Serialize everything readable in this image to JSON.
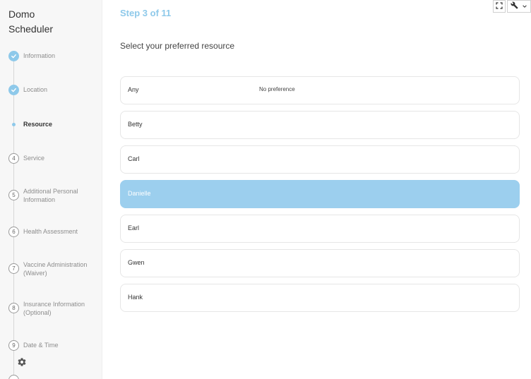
{
  "app": {
    "title_line1": "Domo",
    "title_line2": "Scheduler"
  },
  "steps": [
    {
      "label": "Information",
      "status": "done"
    },
    {
      "label": "Location",
      "status": "done"
    },
    {
      "label": "Resource",
      "status": "current"
    },
    {
      "label": "Service",
      "status": "todo",
      "number": "4"
    },
    {
      "label": "Additional Personal Information",
      "status": "todo",
      "number": "5"
    },
    {
      "label": "Health Assessment",
      "status": "todo",
      "number": "6"
    },
    {
      "label": "Vaccine Administration (Waiver)",
      "status": "todo",
      "number": "7"
    },
    {
      "label": "Insurance Information (Optional)",
      "status": "todo",
      "number": "8"
    },
    {
      "label": "Date & Time",
      "status": "todo",
      "number": "9"
    }
  ],
  "main": {
    "step_count": "Step 3 of 11",
    "prompt": "Select your preferred resource",
    "options": [
      {
        "name": "Any",
        "description": "No preference"
      },
      {
        "name": "Betty"
      },
      {
        "name": "Carl"
      },
      {
        "name": "Danielle",
        "selected": true
      },
      {
        "name": "Earl"
      },
      {
        "name": "Gwen"
      },
      {
        "name": "Hank"
      }
    ]
  },
  "icons": {
    "fullscreen": "fullscreen-icon",
    "wrench": "wrench-icon",
    "chevron": "chevron-down-icon",
    "settings": "gear-icon",
    "check": "check-icon"
  },
  "colors": {
    "accent": "#8ec9ea",
    "selected": "#9ccfee"
  }
}
